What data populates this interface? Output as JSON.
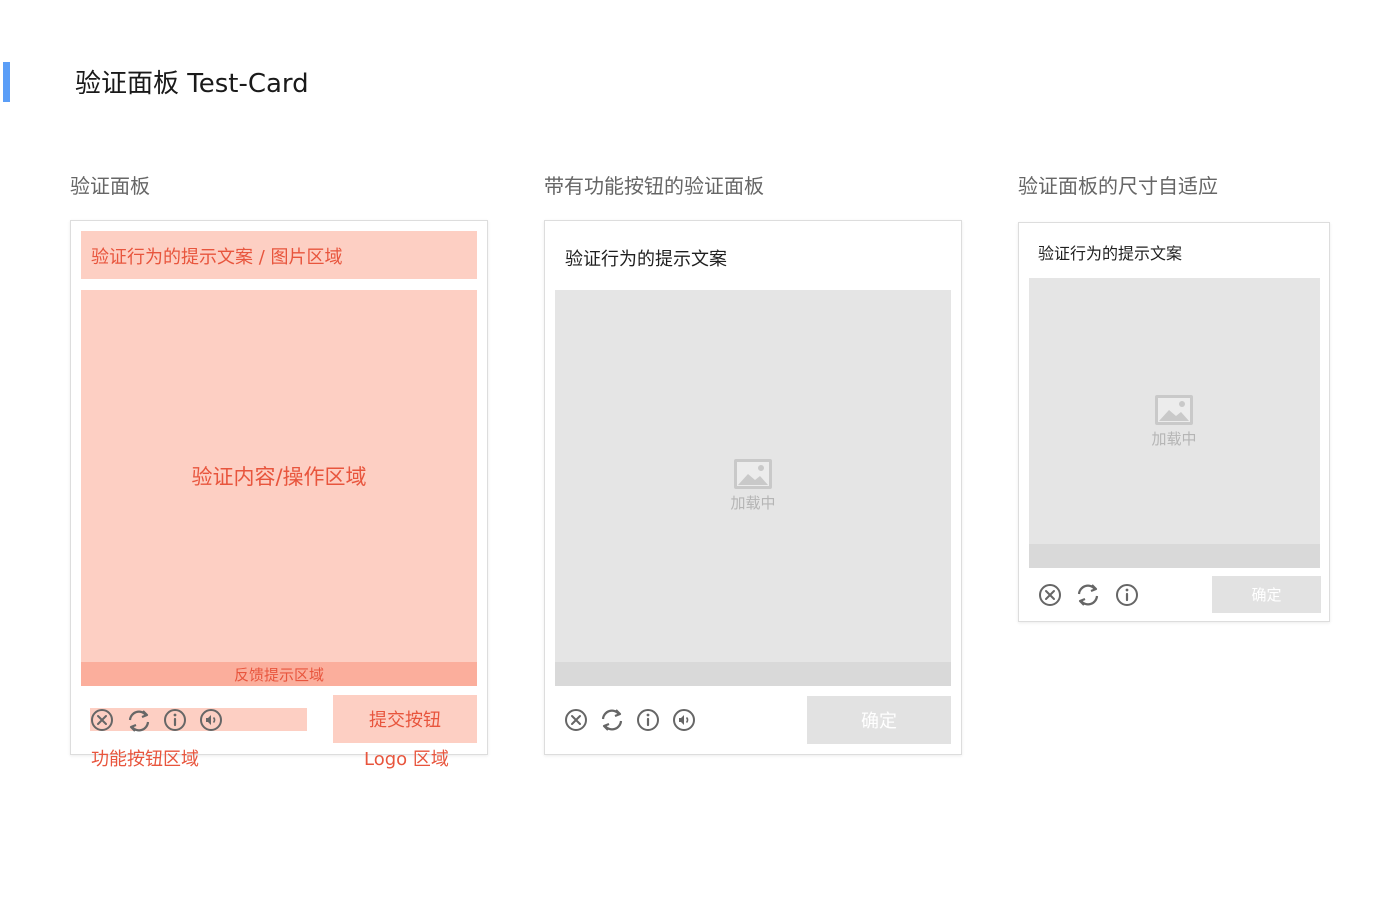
{
  "page": {
    "title": "验证面板 Test-Card",
    "accent_color": "#5b9ef7"
  },
  "sections": [
    {
      "label": "验证面板",
      "annotated_card": {
        "prompt_zone": "验证行为的提示文案 / 图片区域",
        "content_zone": "验证内容/操作区域",
        "feedback_zone": "反馈提示区域",
        "submit_zone": "提交按钮",
        "function_buttons_caption": "功能按钮区域",
        "logo_caption": "Logo 区域",
        "icons": [
          "close-circle-icon",
          "refresh-icon",
          "info-icon",
          "audio-icon"
        ]
      }
    },
    {
      "label": "带有功能按钮的验证面板",
      "card": {
        "prompt": "验证行为的提示文案",
        "loading_text": "加载中",
        "confirm_label": "确定",
        "icons": [
          "close-circle-icon",
          "refresh-icon",
          "info-icon",
          "audio-icon"
        ]
      }
    },
    {
      "label": "验证面板的尺寸自适应",
      "card": {
        "prompt": "验证行为的提示文案",
        "loading_text": "加载中",
        "confirm_label": "确定",
        "icons": [
          "close-circle-icon",
          "refresh-icon",
          "info-icon"
        ]
      }
    }
  ],
  "colors": {
    "zone_fill": "#fdcfc3",
    "zone_text": "#e8553d",
    "feedback_fill": "#fbae9c",
    "panel_gray": "#e5e5e5",
    "strip_gray": "#d9d9d9",
    "icon_gray": "#666666",
    "disabled_text": "#ffffff"
  }
}
